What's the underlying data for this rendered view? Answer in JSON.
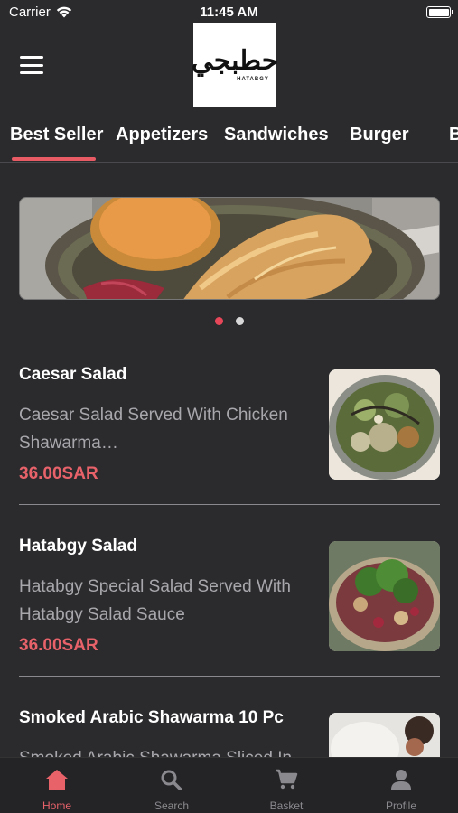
{
  "status_bar": {
    "carrier": "Carrier",
    "time": "11:45 AM"
  },
  "header": {
    "logo_text": "حطبجي",
    "logo_subtext": "HATABGY",
    "menu_icon": "hamburger-icon"
  },
  "categories": [
    {
      "label": "Best Seller",
      "selected": true
    },
    {
      "label": "Appetizers",
      "selected": false
    },
    {
      "label": "Sandwiches",
      "selected": false
    },
    {
      "label": "Burger",
      "selected": false
    },
    {
      "label": "B",
      "selected": false
    }
  ],
  "carousel": {
    "page_count": 2,
    "active_index": 0
  },
  "menu_items": [
    {
      "name": "Caesar Salad",
      "description": "Caesar Salad Served With Chicken Shawarma…",
      "price": "36.00SAR"
    },
    {
      "name": "Hatabgy Salad",
      "description": "Hatabgy Special Salad Served With Hatabgy Salad Sauce",
      "price": "36.00SAR"
    },
    {
      "name": "Smoked Arabic Shawarma 10 Pc",
      "description": "Smoked Arabic Shawarma Sliced In",
      "price": ""
    }
  ],
  "tab_bar": [
    {
      "label": "Home",
      "icon": "home-icon",
      "active": true
    },
    {
      "label": "Search",
      "icon": "search-icon",
      "active": false
    },
    {
      "label": "Basket",
      "icon": "cart-icon",
      "active": false
    },
    {
      "label": "Profile",
      "icon": "profile-icon",
      "active": false
    }
  ],
  "colors": {
    "background": "#2b2b2e",
    "accent": "#e85a64",
    "price": "#e8626a",
    "muted_text": "#a8a8ac"
  }
}
